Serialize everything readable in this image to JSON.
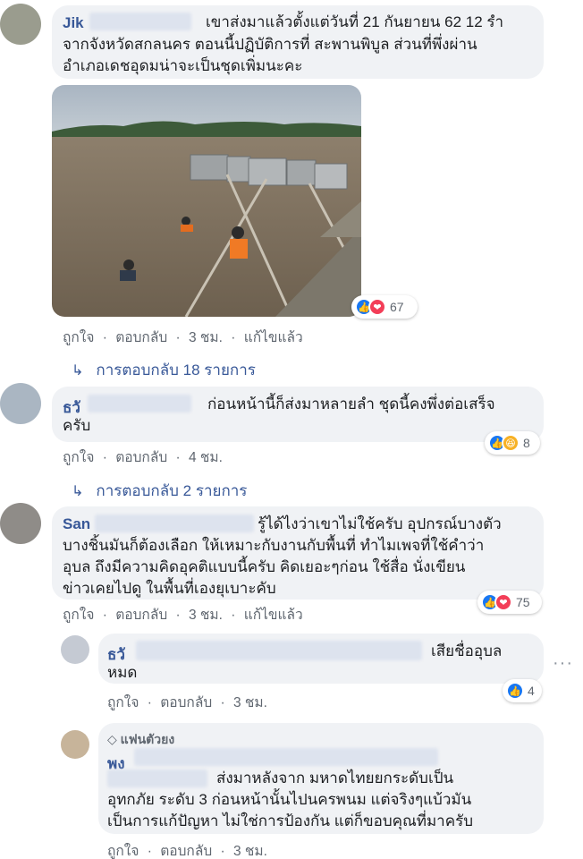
{
  "comments": [
    {
      "author_visible": "Jik",
      "lines": [
        "เขาส่งมาแล้วตั้งแต่วันที่ 21 กันยายน 62 12 รำ",
        "จากจังหวัดสกลนคร ตอนนี้ปฏิบัติการที่ สะพานพิบูล ส่วนที่พึ่งผ่าน",
        "อำเภอเดชอุดมน่าจะเป็นชุดเพิ่มนะคะ"
      ],
      "actions": {
        "like": "ถูกใจ",
        "reply": "ตอบกลับ",
        "time": "3 ชม.",
        "edited": "แก้ไขแล้ว"
      },
      "reaction_count": "67",
      "replies_label": "การตอบกลับ 18 รายการ"
    },
    {
      "author_visible": "ธวั",
      "lines": [
        "ก่อนหน้านี้ก็ส่งมาหลายลำ ชุดนี้คงพึ่งต่อเสร็จ",
        "ครับ"
      ],
      "actions": {
        "like": "ถูกใจ",
        "reply": "ตอบกลับ",
        "time": "4 ชม."
      },
      "reaction_count": "8",
      "replies_label": "การตอบกลับ 2 รายการ"
    },
    {
      "author_visible": "San",
      "lines": [
        "รู้ได้ไงว่าเขาไม่ใช้ครับ อุปกรณ์บางตัว",
        "บางชิ้นมันก็ต้องเลือก ให้เหมาะกับงานกับพื้นที่ ทำไมเพจที่ใช้คำว่า",
        "อุบล ถึงมีความคิดอุคติแบบนี้ครับ คิดเยอะๆก่อน ใช้สื่อ นั่งเขียน",
        "ข่าวเคยไปดู ในพื้นที่เองยุเบาะคับ"
      ],
      "actions": {
        "like": "ถูกใจ",
        "reply": "ตอบกลับ",
        "time": "3 ชม.",
        "edited": "แก้ไขแล้ว"
      },
      "reaction_count": "75"
    },
    {
      "author_visible": "ธวั",
      "lines": [
        "เสียชื่ออุบล",
        "หมด"
      ],
      "actions": {
        "like": "ถูกใจ",
        "reply": "ตอบกลับ",
        "time": "3 ชม."
      },
      "reaction_count": "4"
    },
    {
      "badge": "แฟนตัวยง",
      "author_visible": "พง",
      "lines": [
        "ส่งมาหลังจาก มหาดไทยยกระดับเป็น",
        "อุทกภัย ระดับ 3 ก่อนหน้านั้นไปนครพนม แต่จริงๆแบ้วมัน",
        "เป็นการแก้ปัญหา ไม่ใช่การป้องกัน แต่ก็ขอบคุณที่มาครับ"
      ],
      "actions": {
        "like": "ถูกใจ",
        "reply": "ตอบกลับ",
        "time": "3 ชม."
      }
    }
  ],
  "dot_separator": "·",
  "more_options": "···",
  "colors": {
    "link": "#385898",
    "bubble": "#f0f2f5",
    "like": "#1877f2",
    "love": "#f33e58",
    "haha": "#f7b125"
  }
}
